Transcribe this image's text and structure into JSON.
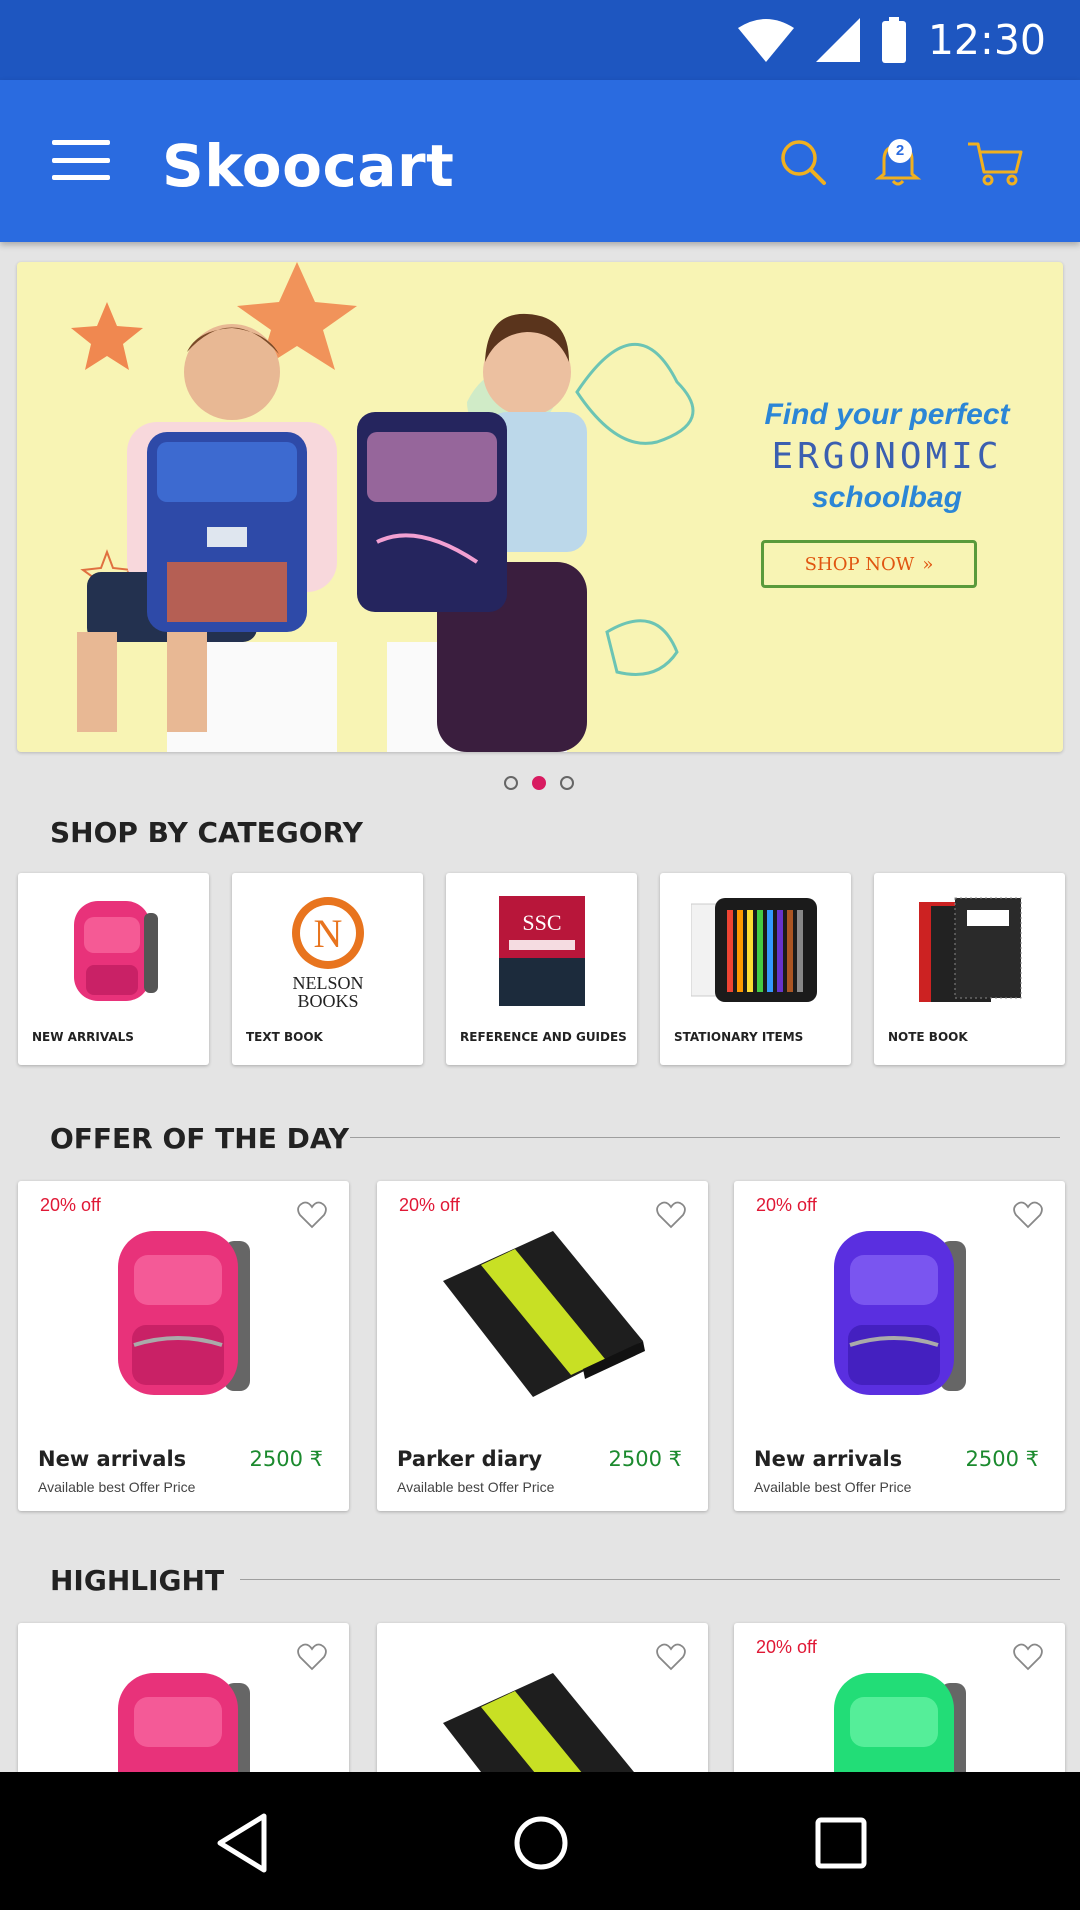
{
  "status_bar": {
    "time": "12:30",
    "icons": [
      "wifi-icon",
      "signal-icon",
      "battery-icon"
    ]
  },
  "app_bar": {
    "title": "Skoocart",
    "notification_count": "2",
    "icons": [
      "menu-icon",
      "search-icon",
      "bell-icon",
      "cart-icon"
    ]
  },
  "banner": {
    "line1": "Find your perfect",
    "line2": "ERGONOMIC",
    "line3": "schoolbag",
    "cta": "SHOP NOW",
    "cta_suffix": "»",
    "carousel": {
      "count": 3,
      "active_index": 1
    }
  },
  "categories": {
    "title": "SHOP BY CATEGORY",
    "items": [
      {
        "label": "NEW ARRIVALS"
      },
      {
        "label": "TEXT BOOK",
        "logo_letter": "N",
        "logo_text_1": "NELSON",
        "logo_text_2": "BOOKS"
      },
      {
        "label": "REFERENCE AND GUIDES",
        "cover_text": "SSC"
      },
      {
        "label": "STATIONARY ITEMS"
      },
      {
        "label": "NOTE BOOK"
      }
    ]
  },
  "offer": {
    "title": "OFFER OF THE DAY",
    "items": [
      {
        "badge": "20% off",
        "name": "New arrivals",
        "price": "2500 ₹",
        "subtitle": "Available best Offer Price",
        "color": "#e8327a"
      },
      {
        "badge": "20% off",
        "name": "Parker diary",
        "price": "2500 ₹",
        "subtitle": "Available best Offer Price"
      },
      {
        "badge": "20% off",
        "name": "New arrivals",
        "price": "2500 ₹",
        "subtitle": "Available best Offer Price",
        "color": "#5a2fe0"
      }
    ]
  },
  "highlight": {
    "title": "HIGHLIGHT",
    "items": [
      {
        "badge": "",
        "color": "#e8327a"
      },
      {
        "badge": ""
      },
      {
        "badge": "20% off",
        "color": "#22dd77"
      }
    ]
  },
  "colors": {
    "status_bar": "#1e56c0",
    "app_bar": "#2a6be0",
    "accent_icons": "#f0b020",
    "offer_badge": "#e01835",
    "price": "#1b8a2e",
    "active_dot": "#d81b60"
  }
}
